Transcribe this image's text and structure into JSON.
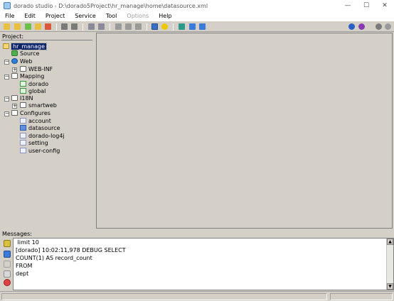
{
  "window": {
    "title": "dorado studio - D:\\dorado5Project\\hr_manage\\home\\datasource.xml",
    "minimize": "—",
    "maximize": "☐",
    "close": "✕"
  },
  "menu": [
    "File",
    "Edit",
    "Project",
    "Service",
    "Tool",
    "Options",
    "Help"
  ],
  "project_label": "Project:",
  "tree": {
    "root": "hr_manage",
    "source": "Source",
    "web": "Web",
    "web_inf": "WEB-INF",
    "mapping": "Mapping",
    "dorado": "dorado",
    "global": "global",
    "i18n": "I18N",
    "smartweb": "smartweb",
    "configures": "Configures",
    "account": "account",
    "datasource": "datasource",
    "dorado_log4j": "dorado-log4j",
    "setting": "setting",
    "user_config": "user-config"
  },
  "messages_label": "Messages:",
  "messages": [
    " limit 10",
    "[dorado] 10:02:11,978 DEBUG SELECT",
    "COUNT(1) AS record_count",
    "FROM",
    "dept"
  ],
  "colors": {
    "selection": "#0a246a",
    "chrome": "#d4d0c8"
  }
}
